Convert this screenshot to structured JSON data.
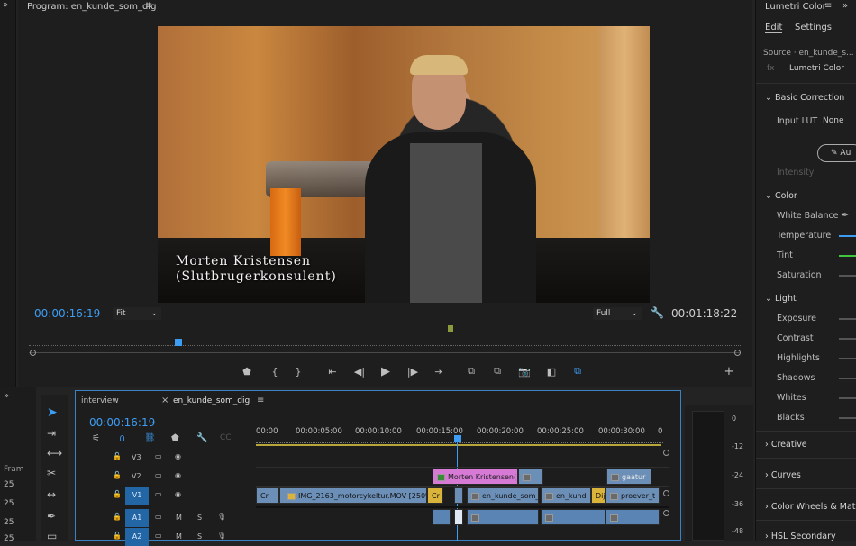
{
  "program": {
    "title": "Program: en_kunde_som_dig",
    "timecode_current": "00:00:16:19",
    "fit_label": "Fit",
    "full_label": "Full",
    "timecode_duration": "00:01:18:22",
    "lower_third_line1": "Morten Kristensen",
    "lower_third_line2": "(Slutbrugerkonsulent)"
  },
  "lumetri": {
    "title": "Lumetri Color",
    "tab_edit": "Edit",
    "tab_settings": "Settings",
    "source": "Source · en_kunde_s...",
    "effect_name": "Lumetri Color",
    "basic_correction": "Basic Correction",
    "input_lut": "Input LUT",
    "input_lut_value": "None",
    "auto": "Au",
    "intensity": "Intensity",
    "color": "Color",
    "white_balance": "White Balance",
    "temperature": "Temperature",
    "tint": "Tint",
    "saturation": "Saturation",
    "light": "Light",
    "exposure": "Exposure",
    "contrast": "Contrast",
    "highlights": "Highlights",
    "shadows": "Shadows",
    "whites": "Whites",
    "blacks": "Blacks",
    "creative": "Creative",
    "curves": "Curves",
    "color_wheels": "Color Wheels & Matc",
    "hsl_secondary": "HSL Secondary"
  },
  "timeline": {
    "tab_interview": "interview",
    "tab_seq": "en_kunde_som_dig",
    "timecode": "00:00:16:19",
    "ruler": [
      "00:00",
      "00:00:05:00",
      "00:00:10:00",
      "00:00:15:00",
      "00:00:20:00",
      "00:00:25:00",
      "00:00:30:00",
      "0"
    ],
    "tracks": {
      "v3": "V3",
      "v2": "V2",
      "v1": "V1",
      "a1": "A1",
      "a2": "A2",
      "m": "M",
      "s": "S"
    },
    "clips": {
      "v2_title": "Morten Kristensen(",
      "v2_gaatur": "gaatur",
      "v1_cr": "Cr",
      "v1_main": "IMG_2163_motorcykeltur.MOV [250%]",
      "v1_cr2": "Cr",
      "v1_seq1": "en_kunde_som_",
      "v1_seq2": "en_kund",
      "v1_di": "Dij",
      "v1_proever": "proever_t"
    }
  },
  "meters": {
    "labels": [
      "0",
      "-12",
      "-24",
      "-36",
      "-48"
    ]
  },
  "left_panel": {
    "label": "Fram",
    "values": [
      "25",
      "25",
      "25",
      "25"
    ]
  }
}
